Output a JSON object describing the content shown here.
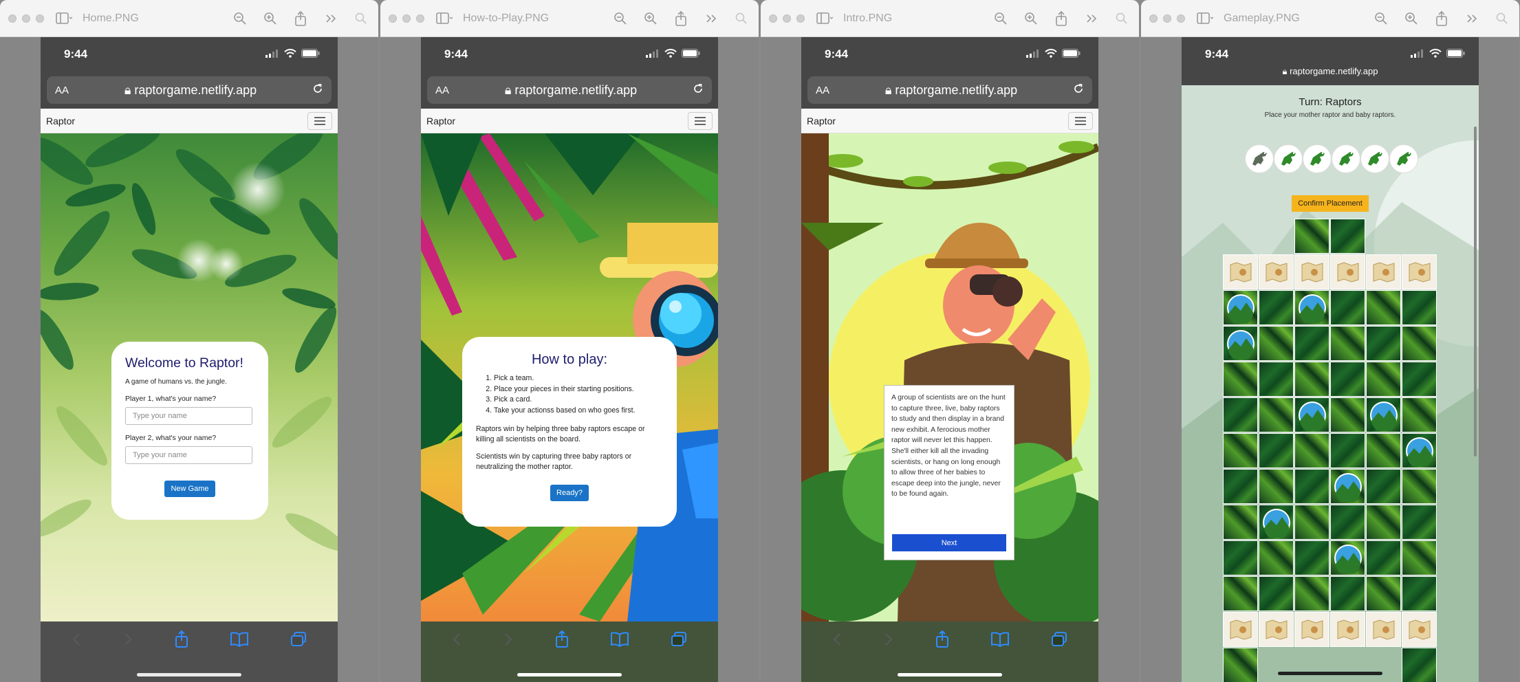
{
  "windows": [
    {
      "title": "Home.PNG",
      "status_time": "9:44",
      "aa_label": "AA",
      "url": "raptorgame.netlify.app",
      "brand": "Raptor",
      "welcome": {
        "title": "Welcome to Raptor!",
        "subtitle": "A game of humans vs. the jungle.",
        "player1_label": "Player 1, what's your name?",
        "player1_placeholder": "Type your name",
        "player2_label": "Player 2, what's your name?",
        "player2_placeholder": "Type your name",
        "button": "New Game"
      }
    },
    {
      "title": "How-to-Play.PNG",
      "status_time": "9:44",
      "aa_label": "AA",
      "url": "raptorgame.netlify.app",
      "brand": "Raptor",
      "howto": {
        "title": "How to play:",
        "steps": [
          "Pick a team.",
          "Place your pieces in their starting positions.",
          "Pick a card.",
          "Take your actionss based on who goes first."
        ],
        "raptors_win": "Raptors win by helping three baby raptors escape or killing all scientists on the board.",
        "scientists_win": "Scientists win by capturing three baby raptors or neutralizing the mother raptor.",
        "button": "Ready?"
      }
    },
    {
      "title": "Intro.PNG",
      "status_time": "9:44",
      "aa_label": "AA",
      "url": "raptorgame.netlify.app",
      "brand": "Raptor",
      "intro": {
        "text": "A group of scientists are on the hunt to capture three, live, baby raptors to study and then display in a brand new exhibit. A ferocious mother raptor will never let this happen. She'll either kill all the invading scientists, or hang on long enough to allow three of her babies to escape deep into the jungle, never to be found again.",
        "button": "Next"
      }
    },
    {
      "title": "Gameplay.PNG",
      "status_time": "9:44",
      "url": "raptorgame.netlify.app",
      "gameplay": {
        "turn": "Turn: Raptors",
        "instruction": "Place your mother raptor and baby raptors.",
        "confirm_button": "Confirm Placement",
        "pieces": [
          "mother-raptor",
          "baby-raptor",
          "baby-raptor",
          "baby-raptor",
          "baby-raptor",
          "baby-raptor"
        ]
      }
    }
  ],
  "colors": {
    "title_navy": "#1d1d6e",
    "button_blue": "#1a73c6",
    "next_blue": "#1a4fd0",
    "confirm_yellow": "#f6b31b",
    "status_bar": "#464646"
  }
}
